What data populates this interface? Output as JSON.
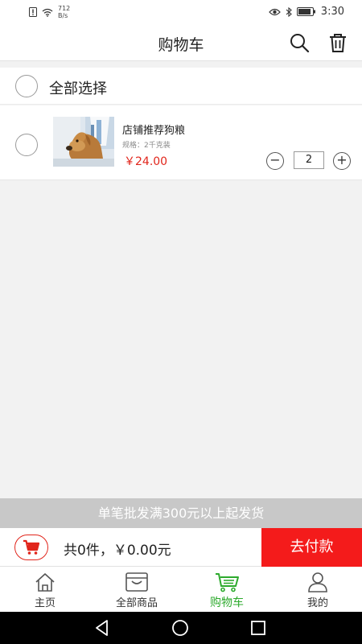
{
  "status_bar": {
    "net_speed_value": "712",
    "net_speed_unit": "B/s",
    "time": "3:30"
  },
  "header": {
    "title": "购物车",
    "search_icon": "search-icon",
    "trash_icon": "trash-icon"
  },
  "select_all": {
    "label": "全部选择",
    "checked": false
  },
  "cart_items": [
    {
      "name": "店铺推荐狗粮",
      "spec": "规格：2千克装",
      "price": "￥24.00",
      "quantity": "2",
      "checked": false
    }
  ],
  "notice": "单笔批发满300元以上起发货",
  "checkout": {
    "summary": "共0件，￥0.00元",
    "button_label": "去付款",
    "accent_color": "#f41b1b"
  },
  "tabs": [
    {
      "label": "主页",
      "icon": "home-icon",
      "active": false
    },
    {
      "label": "全部商品",
      "icon": "store-icon",
      "active": false
    },
    {
      "label": "购物车",
      "icon": "cart-icon",
      "active": true
    },
    {
      "label": "我的",
      "icon": "user-icon",
      "active": false
    }
  ],
  "colors": {
    "active_tab": "#2daa2d",
    "price": "#e1251b"
  }
}
